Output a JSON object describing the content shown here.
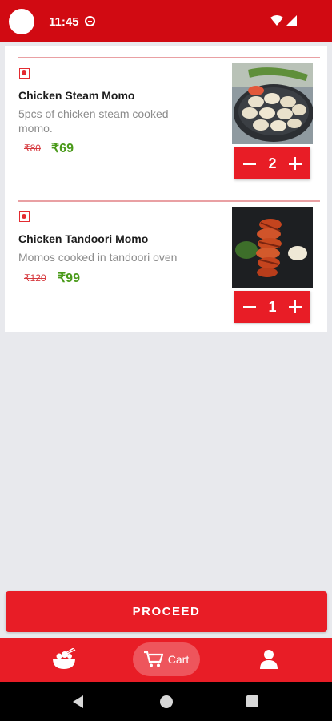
{
  "status_bar": {
    "time": "11:45"
  },
  "cart": {
    "items": [
      {
        "name": "Chicken Steam Momo",
        "description": "5pcs of chicken steam cooked momo.",
        "price_old": "₹80",
        "price_new": "₹69",
        "quantity": "2",
        "image_icon": "steam-momo-photo"
      },
      {
        "name": "Chicken Tandoori Momo",
        "description": "Momos cooked in tandoori oven",
        "price_old": "₹120",
        "price_new": "₹99",
        "quantity": "1",
        "image_icon": "tandoori-momo-photo"
      }
    ]
  },
  "proceed_label": "PROCEED",
  "bottom_nav": {
    "items": [
      {
        "icon": "food-bowl-icon"
      },
      {
        "icon": "cart-icon",
        "label": "Cart",
        "active": true
      },
      {
        "icon": "person-icon"
      }
    ]
  },
  "colors": {
    "brand": "#e81d26",
    "status_bar": "#d10a12",
    "price_green": "#4a9a1a"
  }
}
